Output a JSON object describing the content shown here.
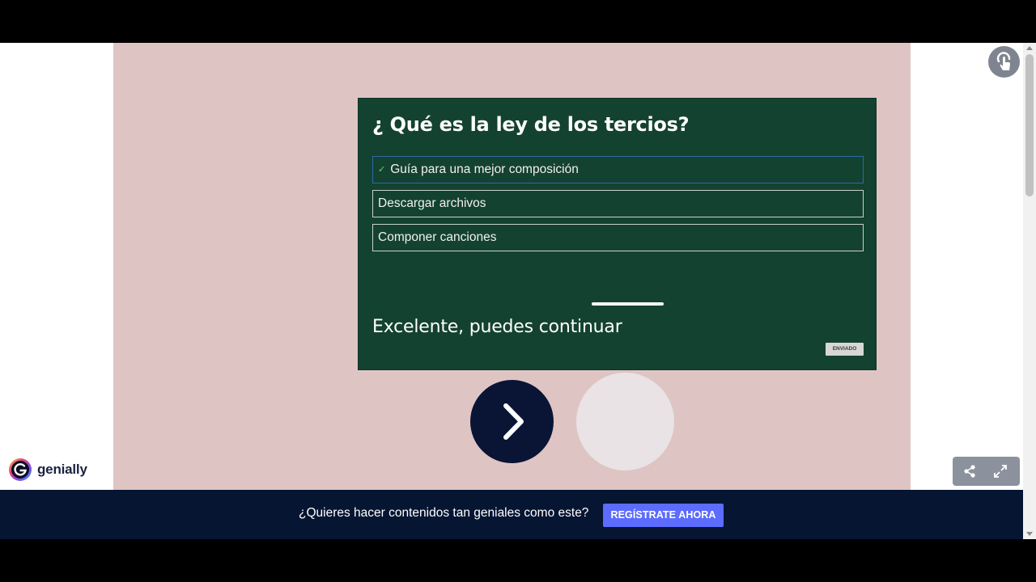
{
  "quiz": {
    "question": "¿ Qué es la ley de los tercios?",
    "options": [
      {
        "label": "Guía para una mejor composición",
        "selected": true
      },
      {
        "label": "Descargar archivos",
        "selected": false
      },
      {
        "label": "Componer canciones",
        "selected": false
      }
    ],
    "feedback": "Excelente, puedes continuar",
    "status_badge": "ENVIADO"
  },
  "icons": {
    "check": "check-icon",
    "next": "chevron-right-icon",
    "lock": "lock-touch-icon",
    "share": "share-icon",
    "fullscreen": "fullscreen-icon",
    "brand": "genially-logo"
  },
  "brand": {
    "name": "genially"
  },
  "cta": {
    "text": "¿Quieres hacer contenidos tan geniales como este?",
    "button_label": "REGÍSTRATE AHORA"
  },
  "colors": {
    "slide_background": "#dfc4c4",
    "card_background": "#144230",
    "next_button": "#0a1535",
    "cta_bar": "#061532",
    "cta_button": "#5b6cff"
  }
}
